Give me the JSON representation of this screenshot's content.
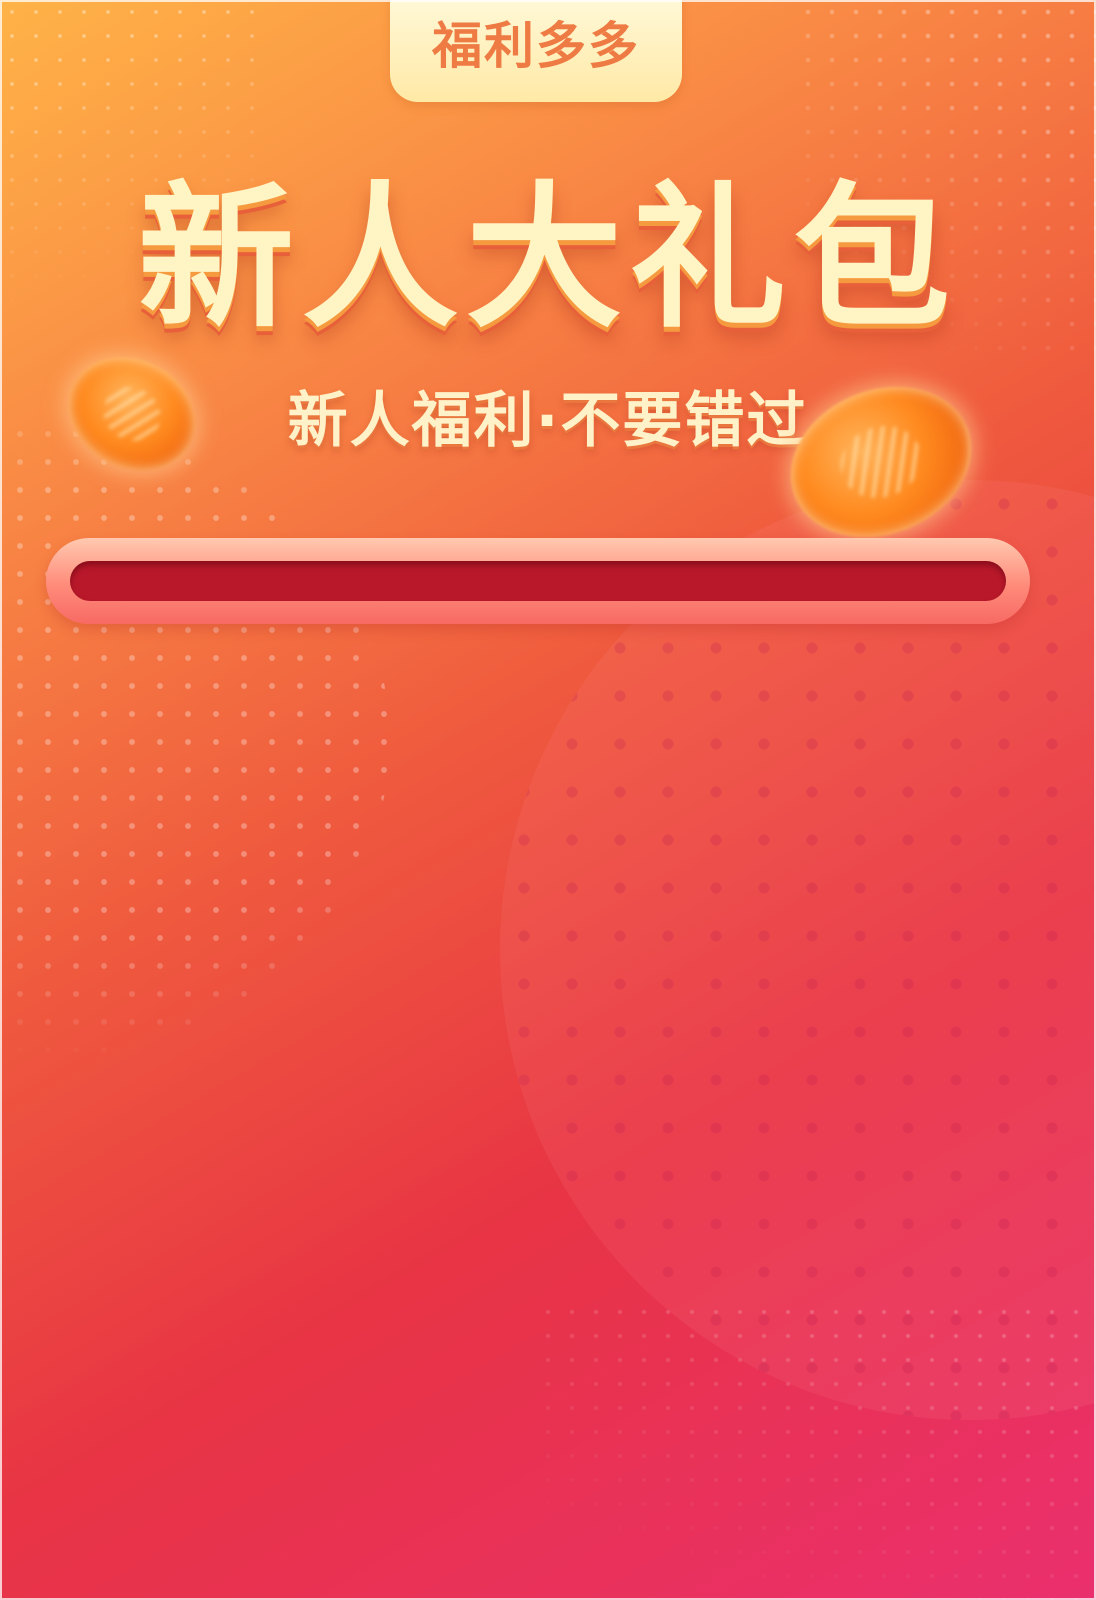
{
  "badge": {
    "text": "福利多多"
  },
  "headline": {
    "title": "新人大礼包",
    "subtitle": "新人福利·不要错过"
  },
  "icons": {
    "coin_left": "gold-coin-icon",
    "coin_right": "gold-coin-icon"
  },
  "colors": {
    "background_top": "#ffb347",
    "background_bottom": "#ea2f6e",
    "badge_bg": "#ffe9a6",
    "badge_text": "#ef7b44",
    "title_text": "#fff4c4",
    "input_frame": "#ff8b7a",
    "input_slot": "#b8182a"
  }
}
